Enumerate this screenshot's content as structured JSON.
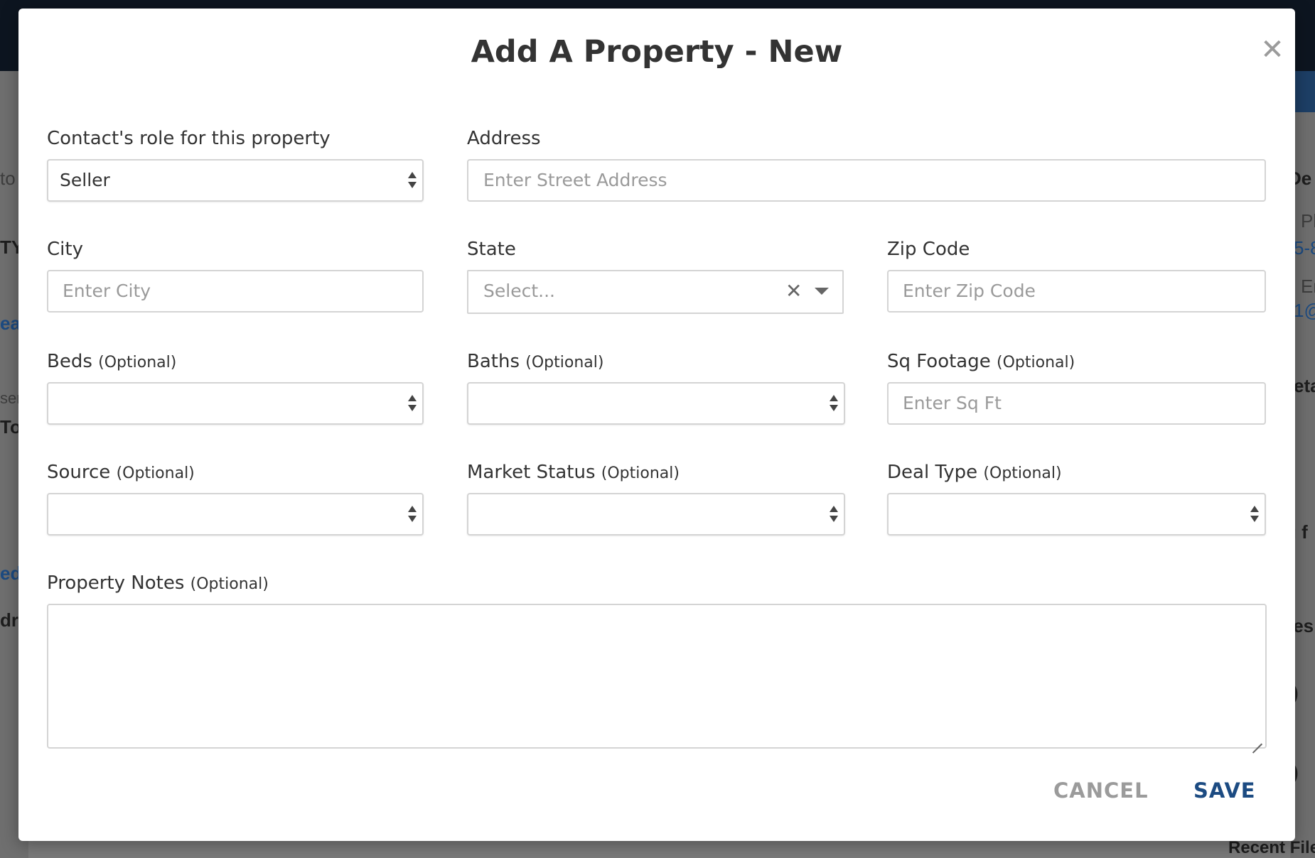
{
  "background": {
    "left_fragments": [
      "to",
      "TY",
      "eat",
      "ser",
      "To",
      "ed",
      "dri"
    ],
    "right_fragments": [
      "De",
      "Pl",
      "5-8",
      "Er",
      "1@",
      "eta",
      "g f",
      "ies",
      ")",
      ")",
      "Recent File"
    ]
  },
  "modal": {
    "title": "Add A Property - New",
    "close_icon": "close-icon"
  },
  "form": {
    "role": {
      "label": "Contact's role for this property",
      "value": "Seller"
    },
    "address": {
      "label": "Address",
      "placeholder": "Enter Street Address"
    },
    "city": {
      "label": "City",
      "placeholder": "Enter City"
    },
    "state": {
      "label": "State",
      "placeholder": "Select..."
    },
    "zip": {
      "label": "Zip Code",
      "placeholder": "Enter Zip Code"
    },
    "beds": {
      "label": "Beds",
      "optional": "(Optional)",
      "value": ""
    },
    "baths": {
      "label": "Baths",
      "optional": "(Optional)",
      "value": ""
    },
    "sqft": {
      "label": "Sq Footage",
      "optional": "(Optional)",
      "placeholder": "Enter Sq Ft"
    },
    "source": {
      "label": "Source",
      "optional": "(Optional)",
      "value": ""
    },
    "market_status": {
      "label": "Market Status",
      "optional": "(Optional)",
      "value": ""
    },
    "deal_type": {
      "label": "Deal Type",
      "optional": "(Optional)",
      "value": ""
    },
    "notes": {
      "label": "Property Notes",
      "optional": "(Optional)",
      "value": ""
    }
  },
  "actions": {
    "cancel_label": "CANCEL",
    "save_label": "SAVE"
  },
  "colors": {
    "save": "#1c4b82",
    "cancel": "#9b9b9b",
    "border": "#d4d4d4"
  }
}
